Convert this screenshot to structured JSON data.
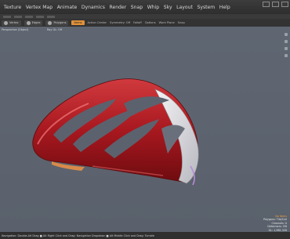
{
  "menubar": {
    "items": [
      "Texture",
      "Vertex Map",
      "Animate",
      "Dynamics",
      "Render",
      "Snap",
      "Whip",
      "Sky",
      "Layout",
      "System",
      "Help"
    ]
  },
  "toolbar": {
    "buttons": [
      "Vertex",
      "Edges",
      "Polygons",
      "Items",
      "Action Center",
      "Symmetry: Off",
      "Falloff",
      "Options",
      "Work Plane",
      "Snap"
    ]
  },
  "viewport": {
    "view_label": "Perspective (Object)",
    "view_mode": "Ray GL: Off"
  },
  "stats": {
    "lines": [
      "No Items",
      "Polygons: Tile/Cull",
      "Channels: 0",
      "Deformers: ON",
      "GL: 1,982,328",
      "0.0 m/s"
    ]
  },
  "status": {
    "text": "Navigation: Double-Alt Drag  ■ Alt Right Click and Drag: Navigation Dropdown  ■ Alt Middle Click and Drag: Tumble"
  },
  "colors": {
    "helmet_red": "#b01e24",
    "helmet_white": "#e8e8ea",
    "accent": "#e0913a",
    "viewport_bg": "#5d6470"
  }
}
